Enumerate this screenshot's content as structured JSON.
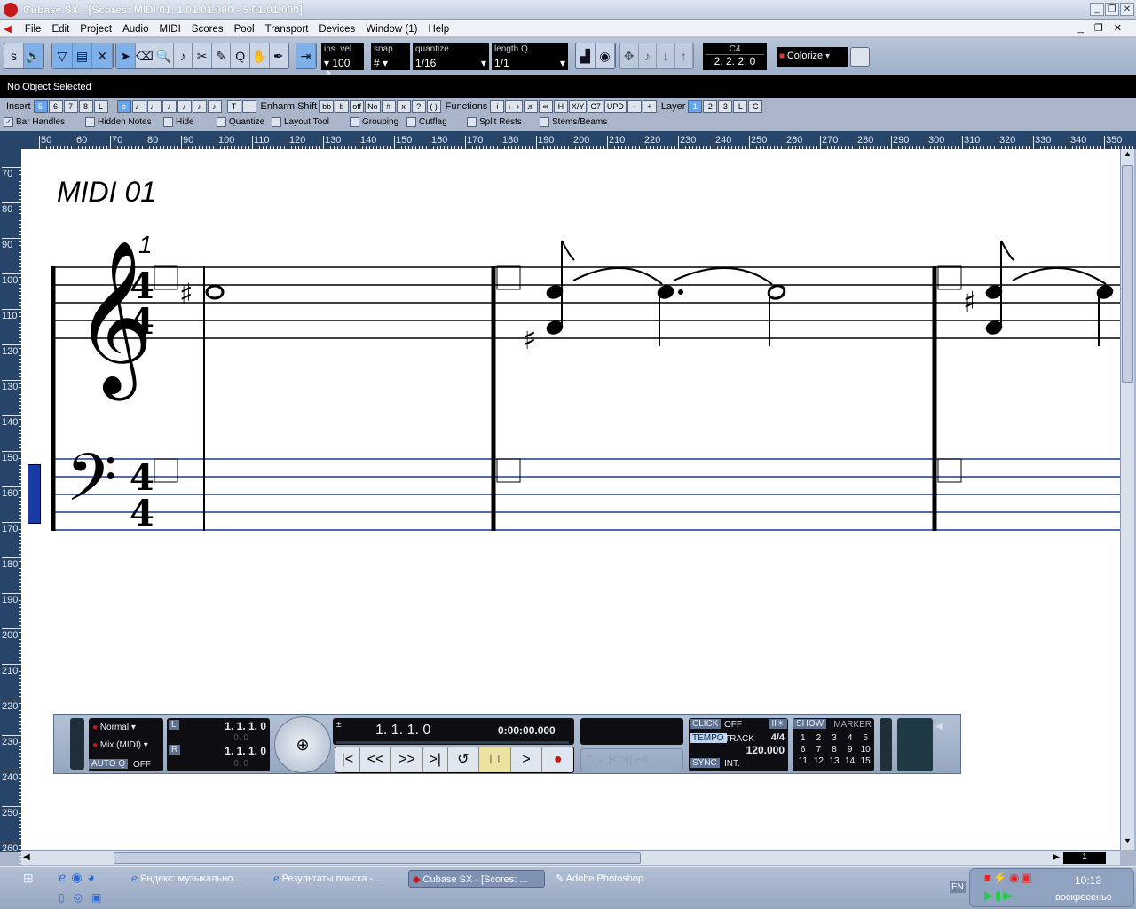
{
  "window": {
    "title": "Cubase SX - [Scores: MIDI 01, 1.01.01.000 - 5.01.01.000]"
  },
  "menu": [
    "File",
    "Edit",
    "Project",
    "Audio",
    "MIDI",
    "Scores",
    "Pool",
    "Transport",
    "Devices",
    "Window (1)",
    "Help"
  ],
  "toolbar": {
    "ins_vel_label": "ins. vel.",
    "ins_vel": "100",
    "snap_label": "snap",
    "quantize_label": "quantize",
    "quantize": "1/16",
    "length_label": "length Q",
    "length": "1/1",
    "pitch": "C4",
    "position": "2. 2. 2.   0",
    "colorize": "Colorize"
  },
  "info": "No Object Selected",
  "insert": {
    "label": "Insert",
    "values": [
      "5",
      "6",
      "7",
      "8",
      "L"
    ],
    "notes": [
      "o",
      "♩",
      "♩",
      "♪",
      "♪",
      "♪",
      "♪"
    ],
    "extra": [
      "T",
      "·"
    ],
    "enharm_label": "Enharm.Shift",
    "enharm": [
      "bb",
      "b",
      "off",
      "No",
      "#",
      "x",
      "?",
      "( )"
    ],
    "functions_label": "Functions",
    "functions": [
      "i",
      "♩♪",
      "♬",
      "⇹",
      "H",
      "X/Y",
      "C7",
      "UPD",
      "−",
      "+"
    ],
    "layer_label": "Layer",
    "layers": [
      "1",
      "2",
      "3",
      "L",
      "G"
    ]
  },
  "checks": [
    {
      "label": "Bar Handles",
      "checked": true
    },
    {
      "label": "Hidden Notes",
      "checked": false
    },
    {
      "label": "Hide",
      "checked": false
    },
    {
      "label": "Quantize",
      "checked": false
    },
    {
      "label": "Layout Tool",
      "checked": false
    },
    {
      "label": "Grouping",
      "checked": false
    },
    {
      "label": "Cutflag",
      "checked": false
    },
    {
      "label": "Split Rests",
      "checked": false
    },
    {
      "label": "Stems/Beams",
      "checked": false
    }
  ],
  "ruler_h": [
    "50",
    "60",
    "70",
    "80",
    "90",
    "100",
    "110",
    "120",
    "130",
    "140",
    "150",
    "160",
    "170",
    "180",
    "190",
    "200",
    "210",
    "220",
    "230",
    "240",
    "250",
    "260",
    "270",
    "280",
    "290",
    "300",
    "310",
    "320",
    "330",
    "340",
    "350"
  ],
  "ruler_v": [
    "70",
    "80",
    "90",
    "100",
    "110",
    "120",
    "130",
    "140",
    "150",
    "160",
    "170",
    "180",
    "190",
    "200",
    "210",
    "220",
    "230",
    "240",
    "250",
    "260"
  ],
  "score": {
    "title": "MIDI 01",
    "bar_number": "1",
    "time_sig": "4"
  },
  "transport": {
    "mode1": "Normal",
    "mode2": "Mix (MIDI)",
    "autoq": "AUTO Q",
    "autoq_val": "OFF",
    "left_loc": "1.  1.  1.    0",
    "left_sub": "0.    0",
    "right_loc": "1.  1.  1.    0",
    "right_sub": "0.    0",
    "position": "1.  1.  1.     0",
    "time": "0:00:00.000",
    "click_label": "CLICK",
    "click": "OFF",
    "tempo_label": "TEMPO",
    "tempo_mode": "TRACK",
    "signature": "4/4",
    "tempo": "120.000",
    "sync_label": "SYNC",
    "sync": "INT.",
    "show_label": "SHOW",
    "marker_label": "MARKER",
    "markers": [
      "1",
      "2",
      "3",
      "4",
      "5",
      "6",
      "7",
      "8",
      "9",
      "10",
      "11",
      "12",
      "13",
      "14",
      "15"
    ]
  },
  "scroll": {
    "page": "1"
  },
  "taskbar": {
    "tasks": [
      "Яндекс: музыкально...",
      "Результаты поиска -...",
      "Cubase SX - [Scores: ...",
      "Adobe Photoshop"
    ],
    "lang": "EN",
    "time": "10:13",
    "day": "воскресенье"
  },
  "colors": {
    "ruler": "#27456b",
    "active": "#67a5ec",
    "bass_staff": "#1a3a9a"
  }
}
